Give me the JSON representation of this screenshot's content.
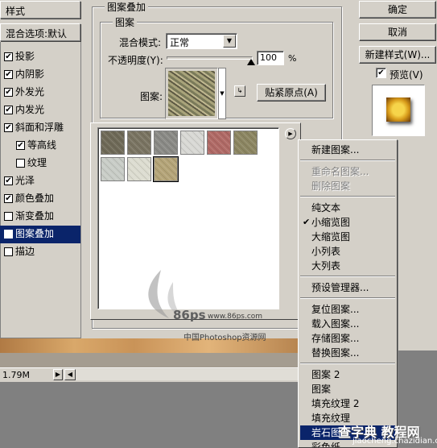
{
  "styles_panel": {
    "header": "样式",
    "blend_options": "混合选项:默认",
    "items": [
      {
        "label": "投影",
        "checked": true,
        "indent": false,
        "selected": false
      },
      {
        "label": "内阴影",
        "checked": true,
        "indent": false,
        "selected": false
      },
      {
        "label": "外发光",
        "checked": true,
        "indent": false,
        "selected": false
      },
      {
        "label": "内发光",
        "checked": true,
        "indent": false,
        "selected": false
      },
      {
        "label": "斜面和浮雕",
        "checked": true,
        "indent": false,
        "selected": false
      },
      {
        "label": "等高线",
        "checked": true,
        "indent": true,
        "selected": false
      },
      {
        "label": "纹理",
        "checked": false,
        "indent": true,
        "selected": false
      },
      {
        "label": "光泽",
        "checked": true,
        "indent": false,
        "selected": false
      },
      {
        "label": "颜色叠加",
        "checked": true,
        "indent": false,
        "selected": false
      },
      {
        "label": "渐变叠加",
        "checked": false,
        "indent": false,
        "selected": false
      },
      {
        "label": "图案叠加",
        "checked": true,
        "indent": false,
        "selected": true
      },
      {
        "label": "描边",
        "checked": false,
        "indent": false,
        "selected": false
      }
    ]
  },
  "pattern_overlay": {
    "title": "图案叠加",
    "group_title": "图案",
    "blend_mode_label": "混合模式:",
    "blend_mode_value": "正常",
    "opacity_label": "不透明度(Y):",
    "opacity_value": "100",
    "opacity_unit": "%",
    "pattern_label": "图案:",
    "snap_origin_button": "贴紧原点(A)"
  },
  "pattern_swatches": {
    "colors": [
      "#6f6a58",
      "#7a7462",
      "#8a8a86",
      "#d8d8d4",
      "#b06a66",
      "#8c8662",
      "#c8ccc6",
      "#dcdcd0",
      "#b4a478"
    ]
  },
  "context_menu": {
    "items": [
      {
        "label": "新建图案...",
        "disabled": false,
        "checked": false,
        "highlighted": false
      },
      {
        "label": "重命名图案...",
        "disabled": true,
        "checked": false,
        "highlighted": false
      },
      {
        "label": "删除图案",
        "disabled": true,
        "checked": false,
        "highlighted": false
      },
      {
        "label": "纯文本",
        "disabled": false,
        "checked": false,
        "highlighted": false
      },
      {
        "label": "小缩览图",
        "disabled": false,
        "checked": true,
        "highlighted": false
      },
      {
        "label": "大缩览图",
        "disabled": false,
        "checked": false,
        "highlighted": false
      },
      {
        "label": "小列表",
        "disabled": false,
        "checked": false,
        "highlighted": false
      },
      {
        "label": "大列表",
        "disabled": false,
        "checked": false,
        "highlighted": false
      },
      {
        "label": "预设管理器...",
        "disabled": false,
        "checked": false,
        "highlighted": false
      },
      {
        "label": "复位图案...",
        "disabled": false,
        "checked": false,
        "highlighted": false
      },
      {
        "label": "载入图案...",
        "disabled": false,
        "checked": false,
        "highlighted": false
      },
      {
        "label": "存储图案...",
        "disabled": false,
        "checked": false,
        "highlighted": false
      },
      {
        "label": "替换图案...",
        "disabled": false,
        "checked": false,
        "highlighted": false
      },
      {
        "label": "图案 2",
        "disabled": false,
        "checked": false,
        "highlighted": false
      },
      {
        "label": "图案",
        "disabled": false,
        "checked": false,
        "highlighted": false
      },
      {
        "label": "填充纹理 2",
        "disabled": false,
        "checked": false,
        "highlighted": false
      },
      {
        "label": "填充纹理",
        "disabled": false,
        "checked": false,
        "highlighted": false
      },
      {
        "label": "岩石图案",
        "disabled": false,
        "checked": false,
        "highlighted": true
      },
      {
        "label": "彩色纸",
        "disabled": false,
        "checked": false,
        "highlighted": false
      }
    ]
  },
  "right_panel": {
    "ok_button": "确定",
    "cancel_button": "取消",
    "new_style_button": "新建样式(W)...",
    "preview_label": "预览(V)",
    "preview_checked": true
  },
  "status_bar": {
    "doc_size": "1.79M"
  },
  "watermark": {
    "logo": "86ps",
    "url": "www.86ps.com",
    "caption": "中国Photoshop资源网"
  },
  "site_mark": {
    "name": "查字典 教程网",
    "url": "jiaocheng.chazidian.com"
  }
}
